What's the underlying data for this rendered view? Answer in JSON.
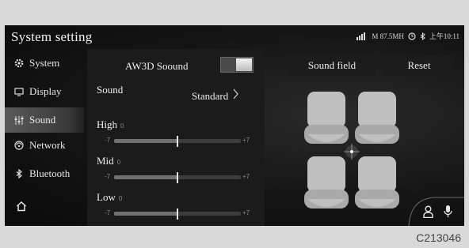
{
  "window": {
    "title": "System setting"
  },
  "status": {
    "signal_text": "M 87.5MH",
    "time": "上午10:11"
  },
  "sidebar": {
    "items": [
      {
        "label": "System",
        "icon": "gear-icon"
      },
      {
        "label": "Display",
        "icon": "monitor-icon"
      },
      {
        "label": "Sound",
        "icon": "equalizer-icon",
        "active": true
      },
      {
        "label": "Network",
        "icon": "network-icon"
      },
      {
        "label": "Bluetooth",
        "icon": "bluetooth-icon"
      }
    ],
    "home_icon": "home-icon"
  },
  "aw3d": {
    "label": "AW3D Soound",
    "enabled": true
  },
  "sound": {
    "label": "Sound",
    "value": "Standard"
  },
  "eq": {
    "min_label": "-7",
    "max_label": "+7",
    "bands": [
      {
        "label": "High",
        "value_text": "0",
        "value": 0
      },
      {
        "label": "Mid",
        "value_text": "0",
        "value": 0
      },
      {
        "label": "Low",
        "value_text": "0",
        "value": 0
      }
    ]
  },
  "buttons": {
    "sound_field": "Sound field",
    "reset": "Reset"
  },
  "bottom_icons": [
    "person-icon",
    "microphone-icon"
  ],
  "watermark": "C213046",
  "colors": {
    "screen_bg": "#0d0d0d",
    "active_item": "#4a4a4a",
    "seat": "#bdbdbd"
  }
}
